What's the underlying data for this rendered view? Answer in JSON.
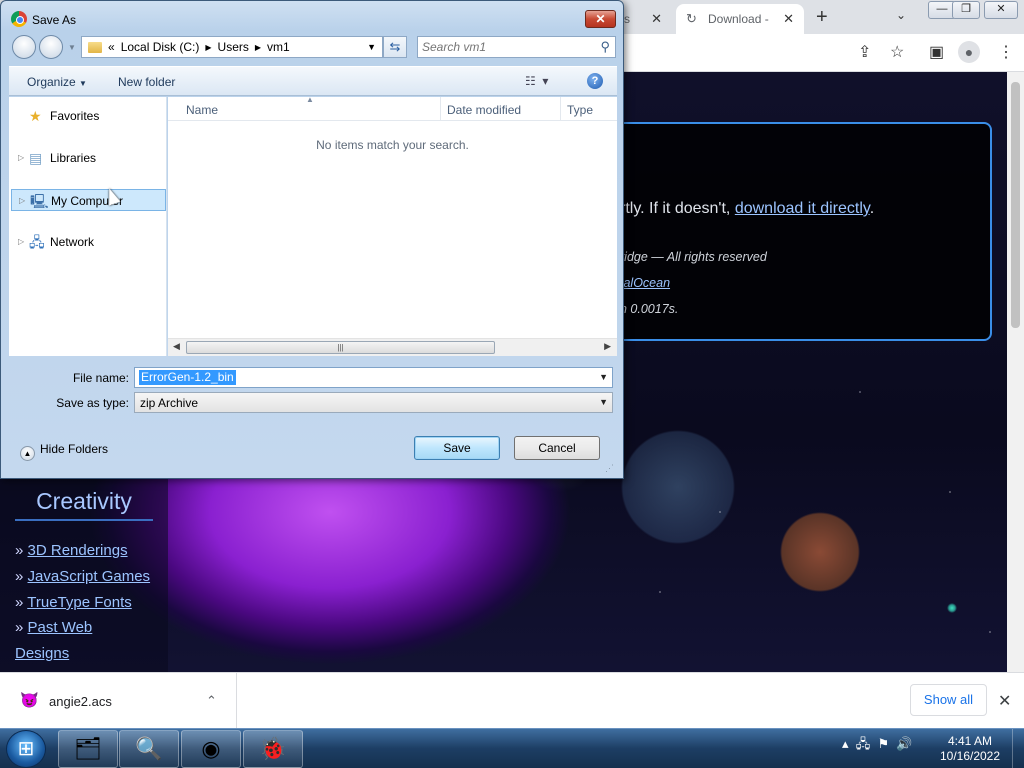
{
  "browser": {
    "tabs": [
      {
        "title": "rms",
        "active": false
      },
      {
        "title": "Download -",
        "active": true
      }
    ],
    "new_tab": "+",
    "tab_search": "⌄",
    "window_controls": {
      "minimize": "—",
      "maximize": "❐",
      "close": "✕"
    },
    "toolbar_icons": [
      "share-icon",
      "star-icon",
      "sidepanel-icon",
      "profile-icon",
      "menu-icon"
    ]
  },
  "page": {
    "download_text": "rtly. If it doesn't,",
    "download_link": "download it directly",
    "download_suffix": ".",
    "footer_line1": "ridge — All rights reserved",
    "footer_line2_link": "talOcean",
    "footer_line3": "n 0.0017s.",
    "sidebar": {
      "heading": "Creativity",
      "links": [
        "3D Renderings",
        "JavaScript Games",
        "TrueType Fonts",
        "Past Web"
      ],
      "trailing_link": "Designs",
      "bullet": "»"
    }
  },
  "download_bar": {
    "filename": "angie2.acs",
    "show_all": "Show all"
  },
  "dialog": {
    "title": "Save As",
    "address": {
      "overflow": "«",
      "crumbs": [
        "Local Disk (C:)",
        "Users",
        "vm1"
      ]
    },
    "search": {
      "placeholder": "Search vm1"
    },
    "commands": {
      "organize": "Organize",
      "new_folder": "New folder"
    },
    "nav_items": [
      {
        "label": "Favorites",
        "icon": "star-icon"
      },
      {
        "label": "Libraries",
        "icon": "library-icon"
      },
      {
        "label": "My Computer",
        "icon": "computer-icon"
      },
      {
        "label": "Network",
        "icon": "network-icon"
      }
    ],
    "columns": [
      "Name",
      "Date modified",
      "Type"
    ],
    "empty_message": "No items match your search.",
    "file_name_label": "File name:",
    "file_name_value": "ErrorGen-1.2_bin",
    "save_as_type_label": "Save as type:",
    "save_as_type_value": "zip Archive",
    "hide_folders": "Hide Folders",
    "save_button": "Save",
    "cancel_button": "Cancel"
  },
  "taskbar": {
    "time": "4:41 AM",
    "date": "10/16/2022",
    "apps": [
      "explorer-icon",
      "search-icon",
      "chrome-icon",
      "bug-app-icon"
    ]
  }
}
